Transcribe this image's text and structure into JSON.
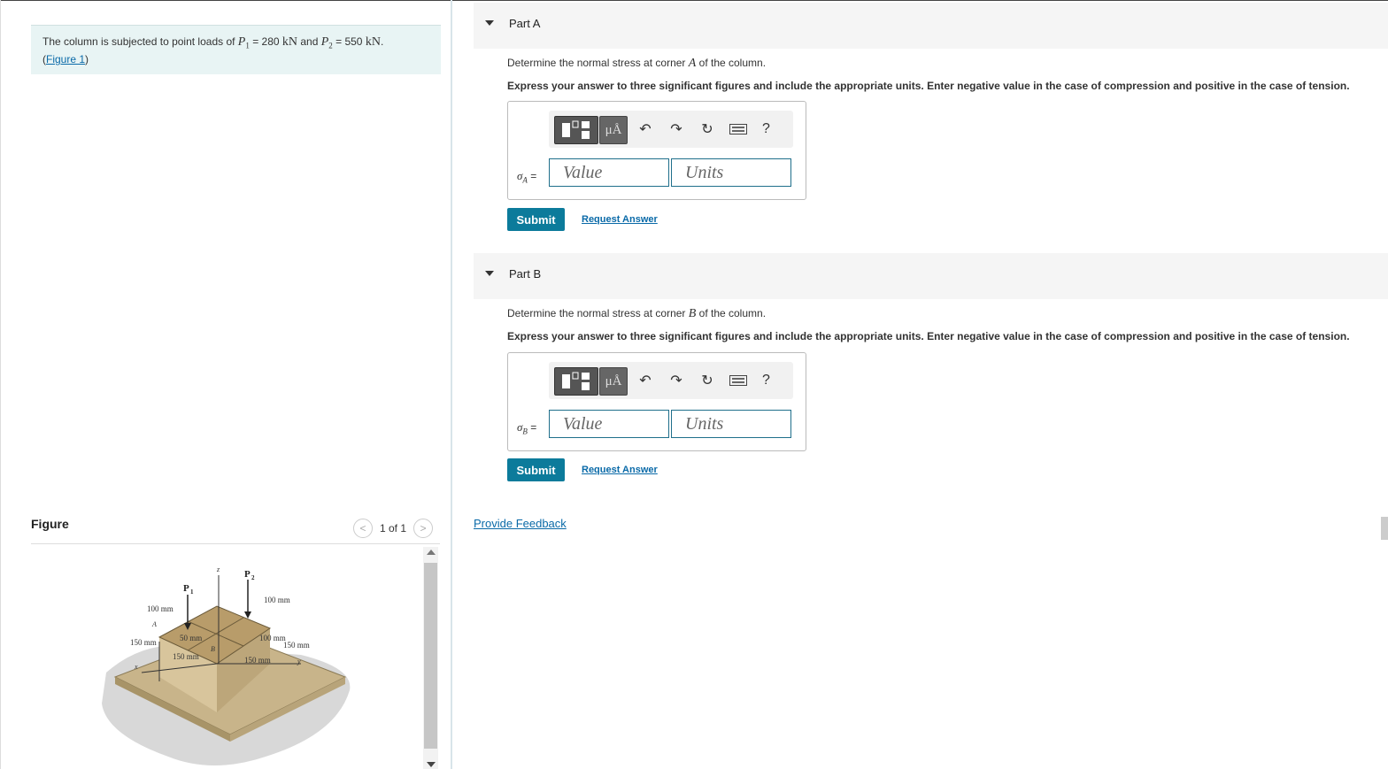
{
  "problem": {
    "prefix": "The column is subjected to point loads of ",
    "p1_sym": "P",
    "p1_sub": "1",
    "p1_val": " = 280 ",
    "unit1": "kN",
    "and_text": " and ",
    "p2_sym": "P",
    "p2_sub": "2",
    "p2_val": " = 550 ",
    "unit2": "kN",
    "period": ".",
    "figure_link": "Figure 1",
    "open_paren": "(",
    "close_paren": ")"
  },
  "figure_panel": {
    "heading": "Figure",
    "counter": "1 of 1",
    "labels": {
      "p1": "P",
      "p1_sub": "1",
      "p2": "P",
      "p2_sub": "2",
      "z": "z",
      "x": "x",
      "y": "y",
      "a": "A",
      "b": "B",
      "dim_100_top_left": "100 mm",
      "dim_100_top_right": "100 mm",
      "dim_150_left": "150 mm",
      "dim_50": "50 mm",
      "dim_150_mid_left": "150 mm",
      "dim_100_mid": "100 mm",
      "dim_150_right": "150 mm",
      "dim_150_bottom": "150 mm"
    }
  },
  "parts": [
    {
      "title": "Part A",
      "question_pre": "Determine the normal stress at corner ",
      "corner": "A",
      "question_post": " of the column.",
      "instruction": "Express your answer to three significant figures and include the appropriate units. Enter negative value in the case of compression and positive in the case of tension.",
      "sigma_sym": "σ",
      "sigma_sub": "A",
      "equals": " =",
      "value_placeholder": "Value",
      "units_placeholder": "Units",
      "submit_label": "Submit",
      "request_label": "Request Answer"
    },
    {
      "title": "Part B",
      "question_pre": "Determine the normal stress at corner ",
      "corner": "B",
      "question_post": " of the column.",
      "instruction": "Express your answer to three significant figures and include the appropriate units. Enter negative value in the case of compression and positive in the case of tension.",
      "sigma_sym": "σ",
      "sigma_sub": "B",
      "equals": " =",
      "value_placeholder": "Value",
      "units_placeholder": "Units",
      "submit_label": "Submit",
      "request_label": "Request Answer"
    }
  ],
  "toolbar": {
    "mu_label": "μÅ",
    "help_label": "?",
    "icons": [
      "templates-icon",
      "units-icon",
      "undo-icon",
      "redo-icon",
      "reset-icon",
      "keyboard-icon",
      "help-icon"
    ]
  },
  "feedback_link": "Provide Feedback",
  "nav": {
    "prev_glyph": "<",
    "next_glyph": ">"
  }
}
